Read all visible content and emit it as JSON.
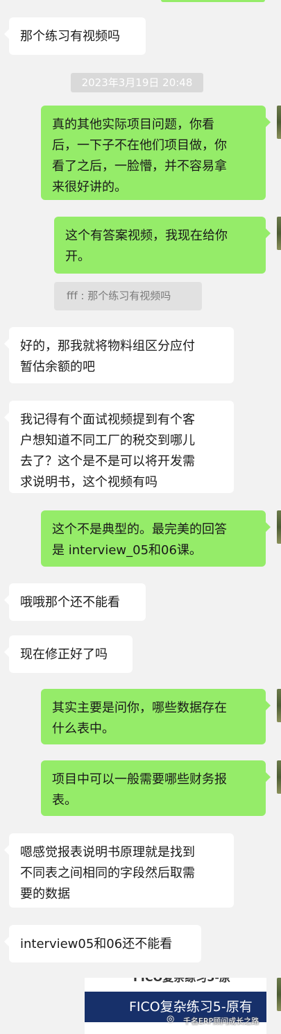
{
  "chat": {
    "timestamp": "2023年3月19日 20:48",
    "messages": [
      {
        "side": "left",
        "text": "那个练习有视频吗"
      },
      {
        "side": "right",
        "text": "真的其他实际项目问题，你看\n后，一下子不在他们项目做，你\n看了之后，一脸懵，并不容易拿\n来很好讲的。"
      },
      {
        "side": "right",
        "text": "这个有答案视频，我现在给你\n开。"
      },
      {
        "side": "left",
        "text": "好的，那我就将物料组区分应付\n暂估余额的吧"
      },
      {
        "side": "left",
        "text": "我记得有个面试视频提到有个客\n户想知道不同工厂的税交到哪儿\n去了？这个是不是可以将开发需\n求说明书，这个视频有吗"
      },
      {
        "side": "right",
        "text": "这个不是典型的。最完美的回答\n是 interview_05和06课。"
      },
      {
        "side": "left",
        "text": "哦哦那个还不能看"
      },
      {
        "side": "left",
        "text": "现在修正好了吗"
      },
      {
        "side": "right",
        "text": "其实主要是问你，哪些数据存在\n什么表中。"
      },
      {
        "side": "right",
        "text": "项目中可以一般需要哪些财务报\n表。"
      },
      {
        "side": "left",
        "text": "嗯感觉报表说明书原理就是找到\n不同表之间相同的字段然后取需\n要的数据"
      },
      {
        "side": "left",
        "text": "interview05和06还不能看"
      }
    ],
    "quote": "fff : 那个练习有视频吗",
    "video_card": {
      "top_text": "FICO复杂练习5-原",
      "banner_text": "FICO复杂练习5-原有"
    },
    "watermark": "千名ERP顾问成长之路",
    "watermark_icon": "wechat-channel-icon"
  }
}
